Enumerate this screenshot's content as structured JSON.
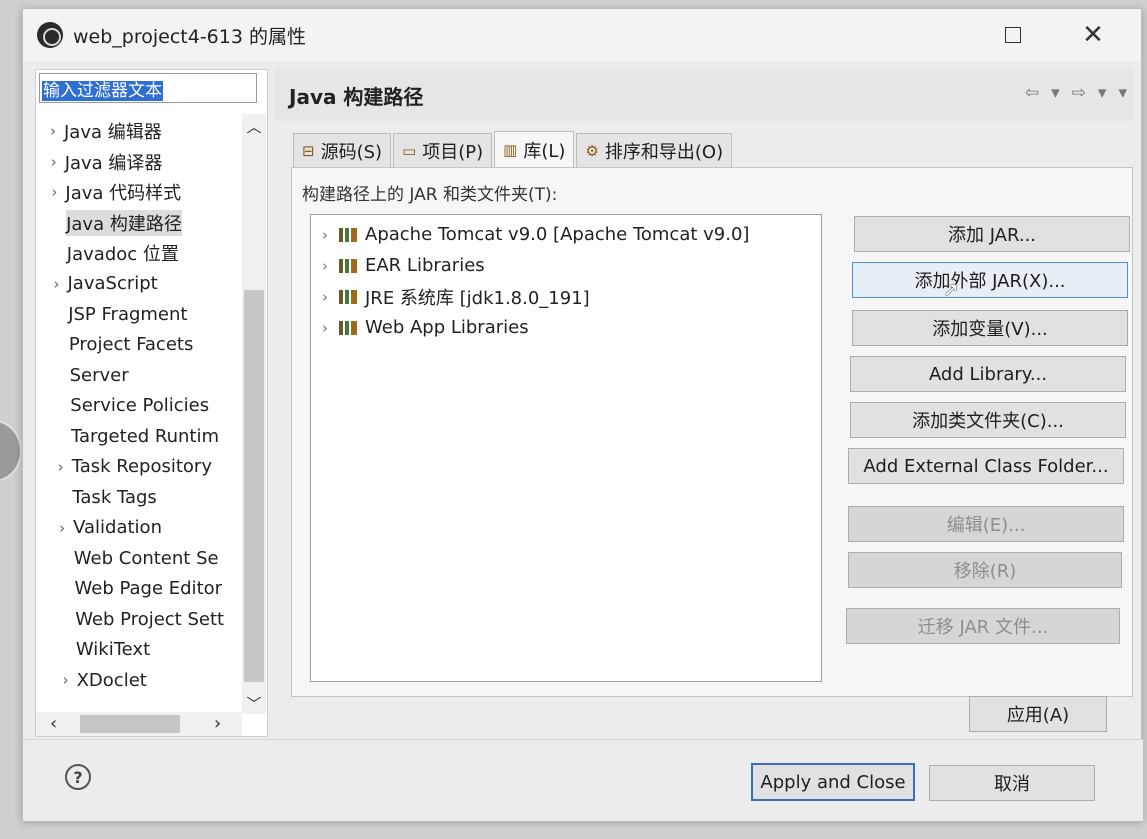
{
  "window": {
    "title": "web_project4-613 的属性",
    "minimize_icon": "restore-icon",
    "close_label": "✕"
  },
  "left": {
    "filter_placeholder": "输入过滤器文本",
    "items": [
      {
        "label": "Java 编辑器",
        "expandable": true
      },
      {
        "label": "Java 编译器",
        "expandable": true
      },
      {
        "label": "Java 代码样式",
        "expandable": true
      },
      {
        "label": "Java 构建路径",
        "expandable": false,
        "selected": true
      },
      {
        "label": "Javadoc 位置",
        "expandable": false
      },
      {
        "label": "JavaScript",
        "expandable": true
      },
      {
        "label": "JSP Fragment",
        "expandable": false
      },
      {
        "label": "Project Facets",
        "expandable": false
      },
      {
        "label": "Server",
        "expandable": false
      },
      {
        "label": "Service Policies",
        "expandable": false
      },
      {
        "label": "Targeted Runtim",
        "expandable": false
      },
      {
        "label": "Task Repository",
        "expandable": true
      },
      {
        "label": "Task Tags",
        "expandable": false
      },
      {
        "label": "Validation",
        "expandable": true
      },
      {
        "label": "Web Content Se",
        "expandable": false
      },
      {
        "label": "Web Page Editor",
        "expandable": false
      },
      {
        "label": "Web Project Sett",
        "expandable": false
      },
      {
        "label": "WikiText",
        "expandable": false
      },
      {
        "label": "XDoclet",
        "expandable": true
      }
    ]
  },
  "main": {
    "page_title": "Java 构建路径",
    "tabs": [
      {
        "label": "源码(S)",
        "icon": "source-folder-icon"
      },
      {
        "label": "项目(P)",
        "icon": "project-icon"
      },
      {
        "label": "库(L)",
        "icon": "library-icon",
        "active": true
      },
      {
        "label": "排序和导出(O)",
        "icon": "order-export-icon"
      }
    ],
    "path_label": "构建路径上的 JAR 和类文件夹(T):",
    "libraries": [
      "Apache Tomcat v9.0 [Apache Tomcat v9.0]",
      "EAR Libraries",
      "JRE 系统库 [jdk1.8.0_191]",
      "Web App Libraries"
    ],
    "buttons": {
      "add_jar": "添加 JAR...",
      "add_external_jar": "添加外部 JAR(X)...",
      "add_variable": "添加变量(V)...",
      "add_library": "Add Library...",
      "add_class_folder": "添加类文件夹(C)...",
      "add_external_class_folder": "Add External Class Folder...",
      "edit": "编辑(E)...",
      "remove": "移除(R)",
      "migrate_jar": "迁移 JAR 文件...",
      "apply": "应用(A)"
    }
  },
  "footer": {
    "help": "?",
    "apply_close": "Apply and Close",
    "cancel": "取消"
  }
}
